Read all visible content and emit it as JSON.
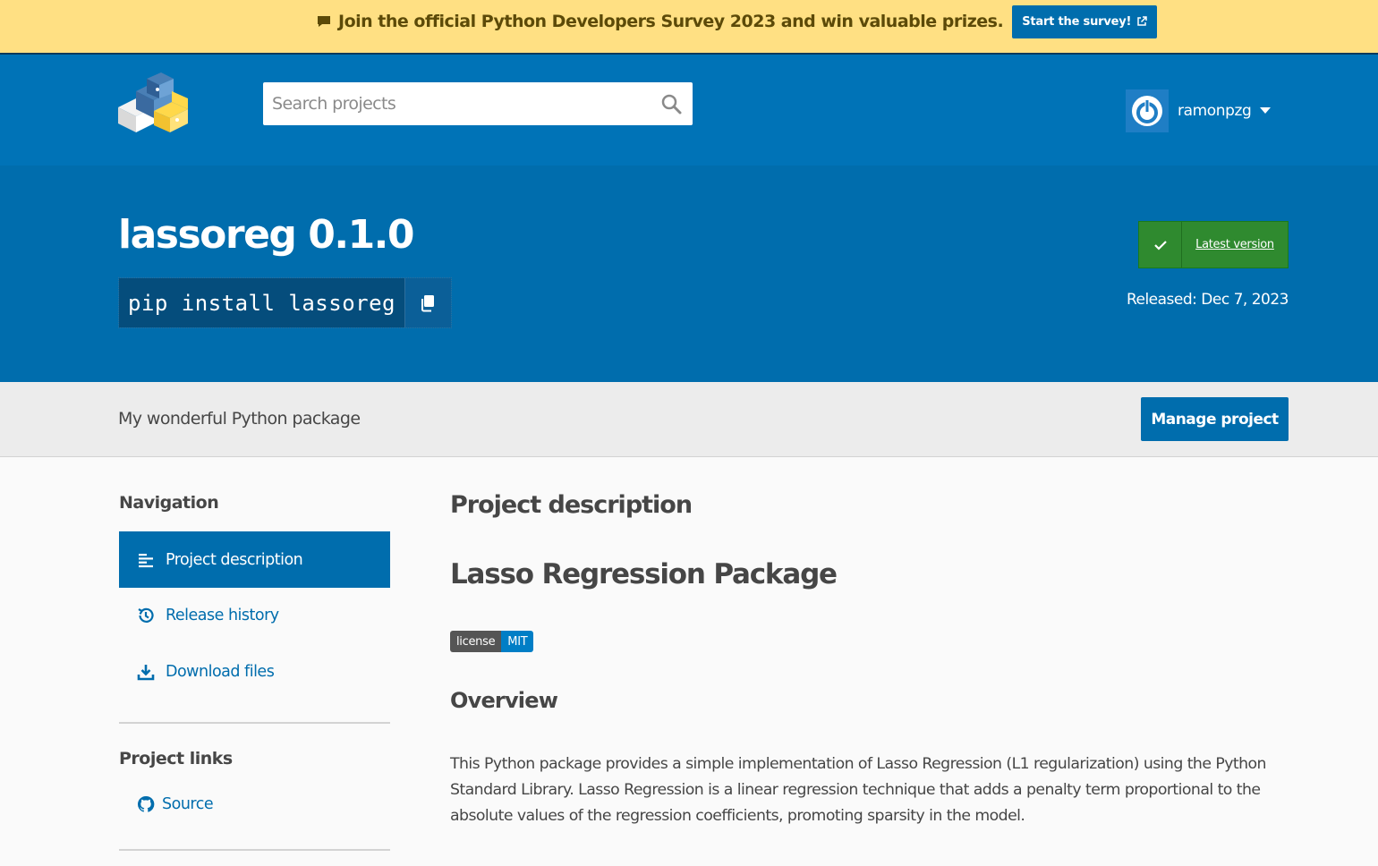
{
  "banner": {
    "text": "Join the official Python Developers Survey 2023 and win valuable prizes.",
    "button_label": "Start the survey!"
  },
  "header": {
    "search_placeholder": "Search projects",
    "username": "ramonpzg"
  },
  "hero": {
    "title": "lassoreg 0.1.0",
    "pip_command": "pip install lassoreg",
    "latest_version_label": "Latest version",
    "released": "Released: Dec 7, 2023"
  },
  "summary": {
    "text": "My wonderful Python package",
    "manage_button": "Manage project"
  },
  "sidebar": {
    "nav_heading": "Navigation",
    "items": [
      {
        "label": "Project description",
        "icon": "align-left-icon",
        "active": true
      },
      {
        "label": "Release history",
        "icon": "history-icon",
        "active": false
      },
      {
        "label": "Download files",
        "icon": "download-icon",
        "active": false
      }
    ],
    "links_heading": "Project links",
    "links": [
      {
        "label": "Source",
        "icon": "github-icon"
      }
    ]
  },
  "main": {
    "section_heading": "Project description",
    "h1": "Lasso Regression Package",
    "badge": {
      "left": "license",
      "right": "MIT"
    },
    "h2": "Overview",
    "paragraph": "This Python package provides a simple implementation of Lasso Regression (L1 regularization) using the Python Standard Library. Lasso Regression is a linear regression technique that adds a penalty term proportional to the absolute values of the regression coefficients, promoting sparsity in the model."
  },
  "colors": {
    "banner_bg": "#ffe083",
    "header_bg": "#0073b7",
    "hero_bg": "#006dad",
    "accent": "#006dad",
    "latest_green": "#2f8a2f"
  }
}
